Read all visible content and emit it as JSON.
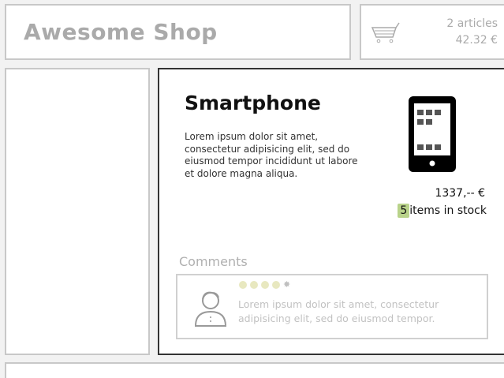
{
  "header": {
    "title": "Awesome Shop"
  },
  "cart": {
    "count_text": "2 articles",
    "total_text": "42.32 €",
    "icon": "shopping-cart-icon"
  },
  "product": {
    "name": "Smartphone",
    "description": "Lorem ipsum dolor sit amet, consectetur adipisicing elit, sed do eiusmod tempor incididunt ut labore et dolore magna aliqua.",
    "price": "1337,-- €",
    "stock_count": "5",
    "stock_label": "items in stock",
    "icon": "smartphone-icon"
  },
  "comments": {
    "heading": "Comments",
    "items": [
      {
        "avatar_icon": "user-avatar-icon",
        "rating_filled": 4,
        "rating_total": 5,
        "text": "Lorem ipsum dolor sit amet, consectetur adipisicing elit, sed do eiusmod tempor."
      }
    ]
  },
  "colors": {
    "stock_highlight": "#b9d38a",
    "panel_border": "#333333",
    "muted_border": "#c8c8c8"
  }
}
